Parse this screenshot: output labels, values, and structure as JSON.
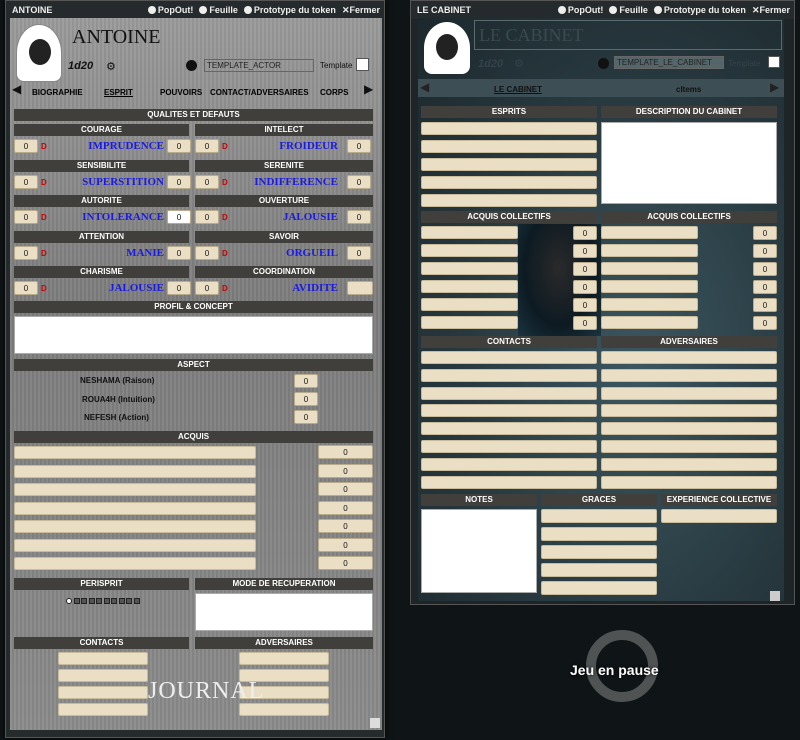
{
  "win1": {
    "title": "ANTOINE",
    "popout": "PopOut!",
    "sheet": "Feuille",
    "token": "Prototype du token",
    "close": "Fermer",
    "name": "ANTOINE",
    "dice": "1d20",
    "template": "TEMPLATE_ACTOR",
    "template_label": "Template",
    "tabs": [
      "BIOGRAPHIE",
      "ESPRIT",
      "POUVOIRS",
      "CONTACT/ADVERSAIRES",
      "CORPS"
    ],
    "qualites": "QUALITES ET DEFAUTS",
    "pairs": [
      {
        "l": "COURAGE",
        "lw": "IMPRUDENCE",
        "lv": "0",
        "lv2": "0",
        "r": "INTELECT",
        "rw": "FROIDEUR",
        "rv": "0",
        "rv2": "0"
      },
      {
        "l": "SENSIBILITE",
        "lw": "SUPERSTITION",
        "lv": "0",
        "lv2": "0",
        "r": "SERENITE",
        "rw": "INDIFFERENCE",
        "rv": "0",
        "rv2": "0"
      },
      {
        "l": "AUTORITE",
        "lw": "INTOLERANCE",
        "lv": "0",
        "lv2": "0",
        "r": "OUVERTURE",
        "rw": "JALOUSIE",
        "rv": "0",
        "rv2": "0"
      },
      {
        "l": "ATTENTION",
        "lw": "MANIE",
        "lv": "0",
        "lv2": "0",
        "r": "SAVOIR",
        "rw": "ORGUEIL",
        "rv": "0",
        "rv2": "0"
      },
      {
        "l": "CHARISME",
        "lw": "JALOUSIE",
        "lv": "0",
        "lv2": "0",
        "r": "COORDINATION",
        "rw": "AVIDITE",
        "rv": "0",
        "rv2": ""
      }
    ],
    "d": "D",
    "profil": "PROFIL & CONCEPT",
    "aspect": "ASPECT",
    "aspects": [
      {
        "n": "NESHAMA (Raison)",
        "v": "0"
      },
      {
        "n": "ROUA4H (Intuition)",
        "v": "0"
      },
      {
        "n": "NEFESH (Action)",
        "v": "0"
      }
    ],
    "acquis": "ACQUIS",
    "acquis_vals": [
      "0",
      "0",
      "0",
      "0",
      "0",
      "0",
      "0"
    ],
    "perisprit": "PERISPRIT",
    "recup": "MODE DE RECUPERATION",
    "contacts": "CONTACTS",
    "adversaires": "ADVERSAIRES",
    "journal": "JOURNAL"
  },
  "win2": {
    "title": "LE CABINET",
    "popout": "PopOut!",
    "sheet": "Feuille",
    "token": "Prototype du token",
    "close": "Fermer",
    "name": "LE CABINET",
    "dice": "1d20",
    "template": "TEMPLATE_LE_CABINET",
    "template_label": "Template",
    "tabs": [
      "LE CABINET",
      "cItems"
    ],
    "esprits": "ESPRITS",
    "description": "DESCRIPTION DU CABINET",
    "acquis_l": "ACQUIS COLLECTIFS",
    "acquis_r": "ACQUIS COLLECTIFS",
    "acq_vals": [
      "0",
      "0",
      "0",
      "0",
      "0",
      "0"
    ],
    "contacts": "CONTACTS",
    "adversaires": "ADVERSAIRES",
    "notes": "NOTES",
    "graces": "GRACES",
    "experience": "EXPERIENCE COLLECTIVE"
  },
  "pause": "Jeu en pause"
}
